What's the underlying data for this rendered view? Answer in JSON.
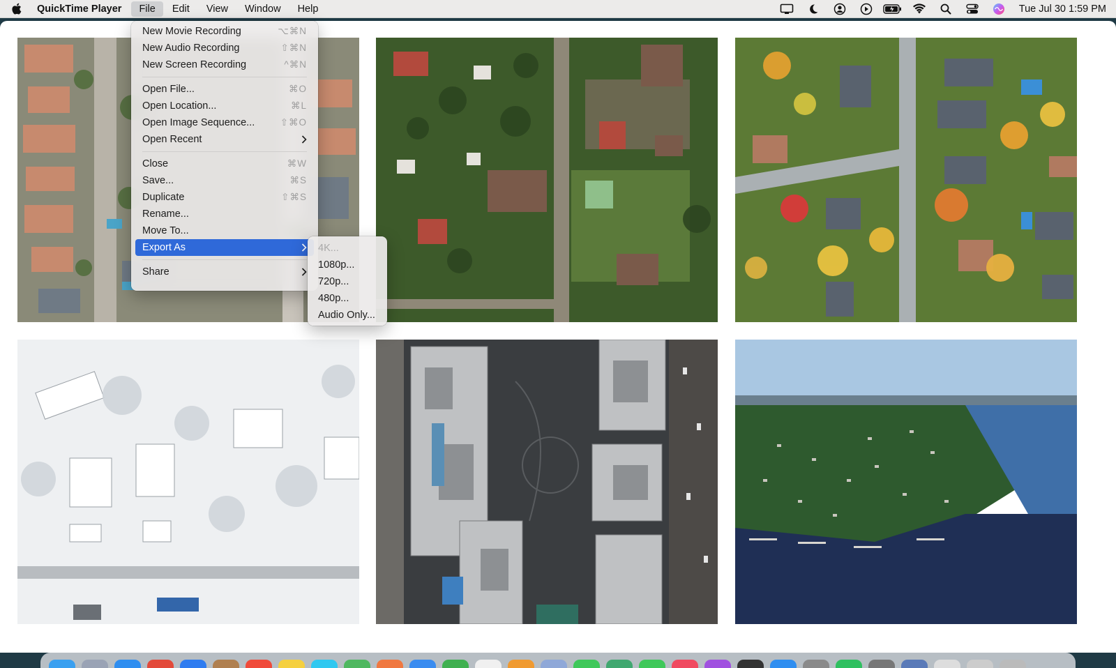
{
  "menubar": {
    "app_name": "QuickTime Player",
    "menus": [
      "File",
      "Edit",
      "View",
      "Window",
      "Help"
    ],
    "clock": "Tue Jul 30  1:59 PM"
  },
  "file_menu": {
    "groups": [
      [
        {
          "label": "New Movie Recording",
          "shortcut": "⌥⌘N"
        },
        {
          "label": "New Audio Recording",
          "shortcut": "⇧⌘N"
        },
        {
          "label": "New Screen Recording",
          "shortcut": "^⌘N"
        }
      ],
      [
        {
          "label": "Open File...",
          "shortcut": "⌘O"
        },
        {
          "label": "Open Location...",
          "shortcut": "⌘L"
        },
        {
          "label": "Open Image Sequence...",
          "shortcut": "⇧⌘O"
        },
        {
          "label": "Open Recent",
          "shortcut": ""
        }
      ],
      [
        {
          "label": "Close",
          "shortcut": "⌘W"
        },
        {
          "label": "Save...",
          "shortcut": "⌘S"
        },
        {
          "label": "Duplicate",
          "shortcut": "⇧⌘S"
        },
        {
          "label": "Rename...",
          "shortcut": ""
        },
        {
          "label": "Move To...",
          "shortcut": ""
        },
        {
          "label": "Export As",
          "shortcut": ""
        }
      ],
      [
        {
          "label": "Share",
          "shortcut": ""
        }
      ]
    ]
  },
  "export_submenu": {
    "items": [
      "4K...",
      "1080p...",
      "720p...",
      "480p...",
      "Audio Only..."
    ]
  },
  "colors": {
    "highlight": "#2f69d9",
    "menubar_bg": "#ecebea",
    "window_bg": "#ffffff",
    "desktop": "#1f3a45"
  }
}
